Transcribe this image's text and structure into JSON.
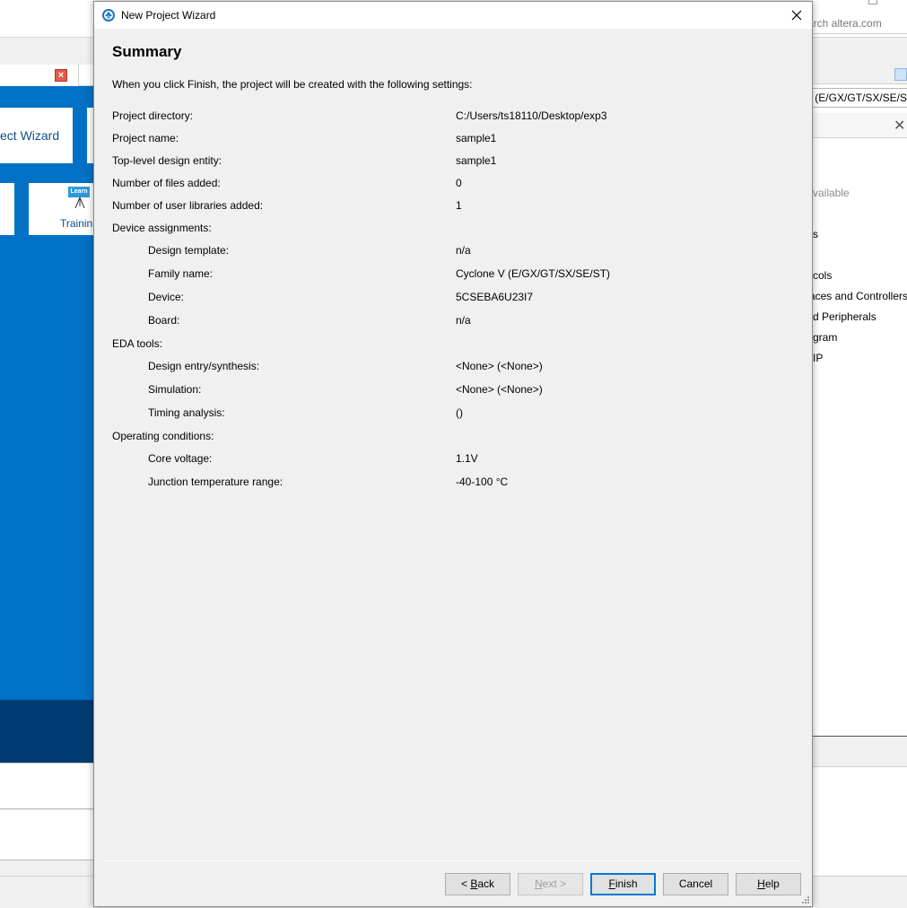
{
  "background": {
    "search_text": "arch altera.com",
    "left_tab_close": "×",
    "card_wizard_label": "ect Wizard",
    "learn_badge": "Learn",
    "training_label": "Trainin",
    "family_field_text": "/ (E/GX/GT/SX/SE/S",
    "catalog_items": [
      {
        "text": "vailable",
        "muted": true
      },
      {
        "text": "s",
        "muted": false
      },
      {
        "text": "cols",
        "muted": false
      },
      {
        "text": "aces and Controllers",
        "muted": false
      },
      {
        "text": "d Peripherals",
        "muted": false
      },
      {
        "text": "gram",
        "muted": false
      },
      {
        "text": "IP",
        "muted": false
      }
    ]
  },
  "dialog": {
    "title": "New Project Wizard",
    "heading": "Summary",
    "intro": "When you click Finish, the project will be created with the following settings:",
    "rows": [
      {
        "label": "Project directory:",
        "value": "C:/Users/ts18110/Desktop/exp3",
        "level": 0
      },
      {
        "label": "Project name:",
        "value": "sample1",
        "level": 0
      },
      {
        "label": "Top-level design entity:",
        "value": "sample1",
        "level": 0
      },
      {
        "label": "Number of files added:",
        "value": "0",
        "level": 0
      },
      {
        "label": "Number of user libraries added:",
        "value": "1",
        "level": 0
      },
      {
        "label": "Device assignments:",
        "value": "",
        "level": 0
      },
      {
        "label": "Design template:",
        "value": "n/a",
        "level": 1
      },
      {
        "label": "Family name:",
        "value": "Cyclone V (E/GX/GT/SX/SE/ST)",
        "level": 1
      },
      {
        "label": "Device:",
        "value": "5CSEBA6U23I7",
        "level": 1
      },
      {
        "label": "Board:",
        "value": "n/a",
        "level": 1
      },
      {
        "label": "EDA tools:",
        "value": "",
        "level": 0
      },
      {
        "label": "Design entry/synthesis:",
        "value": "<None> (<None>)",
        "level": 1
      },
      {
        "label": "Simulation:",
        "value": "<None> (<None>)",
        "level": 1
      },
      {
        "label": "Timing analysis:",
        "value": " ()",
        "level": 1
      },
      {
        "label": "Operating conditions:",
        "value": "",
        "level": 0
      },
      {
        "label": "Core voltage:",
        "value": "1.1V",
        "level": 1
      },
      {
        "label": "Junction temperature range:",
        "value": "-40-100 °C",
        "level": 1
      }
    ],
    "buttons": {
      "back": {
        "prefix": "< ",
        "mnemonic": "B",
        "rest": "ack",
        "enabled": true
      },
      "next": {
        "prefix": "",
        "mnemonic": "N",
        "rest": "ext >",
        "enabled": false
      },
      "finish": {
        "prefix": "",
        "mnemonic": "F",
        "rest": "inish",
        "enabled": true
      },
      "cancel": {
        "prefix": "",
        "mnemonic": "",
        "rest": "Cancel",
        "enabled": true
      },
      "help": {
        "prefix": "",
        "mnemonic": "H",
        "rest": "elp",
        "enabled": true
      }
    }
  },
  "colors": {
    "brand_blue": "#0071c5",
    "dark_blue": "#003c71",
    "default_button_border": "#0078d7"
  }
}
